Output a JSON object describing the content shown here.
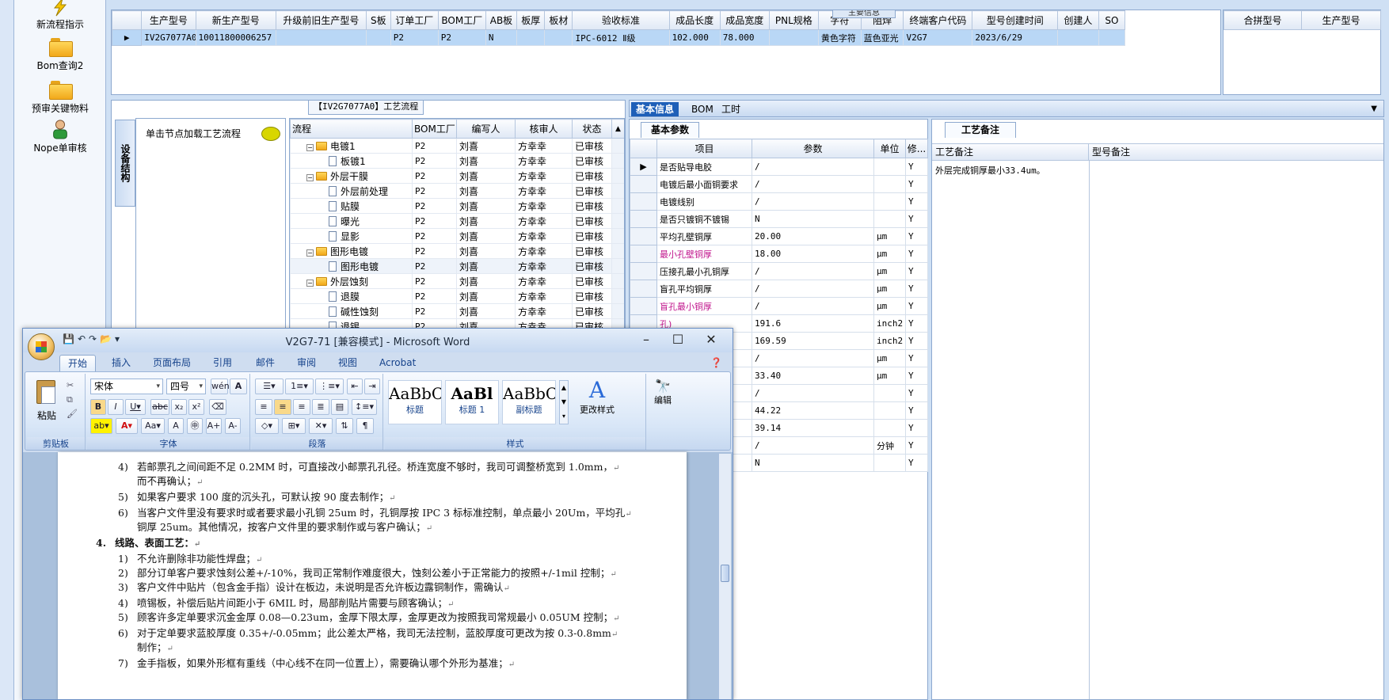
{
  "launcher": {
    "items": [
      {
        "label": "新流程指示"
      },
      {
        "label": "Bom查询2"
      },
      {
        "label": "预审关键物料"
      },
      {
        "label": "Nope单审核"
      }
    ]
  },
  "top_grid": {
    "caption": "主要信息",
    "columns": [
      "生产型号",
      "新生产型号",
      "升级前旧生产型号",
      "S板",
      "订单工厂",
      "BOM工厂",
      "AB板",
      "板厚",
      "板材",
      "验收标准",
      "成品长度",
      "成品宽度",
      "PNL规格",
      "字符",
      "阻焊",
      "终端客户代码",
      "型号创建时间",
      "创建人",
      "SO"
    ],
    "rows": [
      [
        "IV2G7077A0",
        "10011800006257",
        "",
        "",
        "P2",
        "P2",
        "N",
        "",
        "",
        "IPC-6012 Ⅱ级",
        "102.000",
        "78.000",
        "",
        "黄色字符",
        "蓝色亚光",
        "V2G7",
        "2023/6/29",
        "",
        ""
      ]
    ]
  },
  "right_grid": {
    "columns": [
      "合拼型号",
      "生产型号"
    ]
  },
  "flow_panel": {
    "title": "【IV2G7077A0】工艺流程",
    "side_tab": "设备结构",
    "node_hint": "单击节点加载工艺流程",
    "columns": [
      "流程",
      "BOM工厂",
      "编写人",
      "核审人",
      "状态"
    ],
    "rows": [
      {
        "name": "电镀1",
        "type": "folder",
        "factory": "P2",
        "writer": "刘喜",
        "reviewer": "方幸幸",
        "status": "已审核"
      },
      {
        "name": "板镀1",
        "type": "file",
        "factory": "P2",
        "writer": "刘喜",
        "reviewer": "方幸幸",
        "status": "已审核"
      },
      {
        "name": "外层干膜",
        "type": "folder",
        "factory": "P2",
        "writer": "刘喜",
        "reviewer": "方幸幸",
        "status": "已审核"
      },
      {
        "name": "外层前处理",
        "type": "file",
        "factory": "P2",
        "writer": "刘喜",
        "reviewer": "方幸幸",
        "status": "已审核"
      },
      {
        "name": "贴膜",
        "type": "file",
        "factory": "P2",
        "writer": "刘喜",
        "reviewer": "方幸幸",
        "status": "已审核"
      },
      {
        "name": "曝光",
        "type": "file",
        "factory": "P2",
        "writer": "刘喜",
        "reviewer": "方幸幸",
        "status": "已审核"
      },
      {
        "name": "显影",
        "type": "file",
        "factory": "P2",
        "writer": "刘喜",
        "reviewer": "方幸幸",
        "status": "已审核"
      },
      {
        "name": "图形电镀",
        "type": "folder",
        "factory": "P2",
        "writer": "刘喜",
        "reviewer": "方幸幸",
        "status": "已审核"
      },
      {
        "name": "图形电镀",
        "type": "file",
        "factory": "P2",
        "writer": "刘喜",
        "reviewer": "方幸幸",
        "status": "已审核"
      },
      {
        "name": "外层蚀刻",
        "type": "folder",
        "factory": "P2",
        "writer": "刘喜",
        "reviewer": "方幸幸",
        "status": "已审核"
      },
      {
        "name": "退膜",
        "type": "file",
        "factory": "P2",
        "writer": "刘喜",
        "reviewer": "方幸幸",
        "status": "已审核"
      },
      {
        "name": "碱性蚀刻",
        "type": "file",
        "factory": "P2",
        "writer": "刘喜",
        "reviewer": "方幸幸",
        "status": "已审核"
      },
      {
        "name": "退锡",
        "type": "file",
        "factory": "P2",
        "writer": "刘喜",
        "reviewer": "方幸幸",
        "status": "已审核"
      }
    ]
  },
  "info_tabs": [
    "基本信息",
    "BOM",
    "工时"
  ],
  "basic_params": {
    "tab": "基本参数",
    "columns": [
      "项目",
      "参数",
      "单位",
      "修..."
    ],
    "rows": [
      {
        "item": "是否贴导电胶",
        "param": "/",
        "unit": "",
        "flag": "Y",
        "pink": false
      },
      {
        "item": "电镀后最小面铜要求",
        "param": "/",
        "unit": "",
        "flag": "Y",
        "pink": false
      },
      {
        "item": "电镀线别",
        "param": "/",
        "unit": "",
        "flag": "Y",
        "pink": false
      },
      {
        "item": "是否只镀铜不镀锡",
        "param": "N",
        "unit": "",
        "flag": "Y",
        "pink": false
      },
      {
        "item": "平均孔壁铜厚",
        "param": "20.00",
        "unit": "μm",
        "flag": "Y",
        "pink": false
      },
      {
        "item": "最小孔壁铜厚",
        "param": "18.00",
        "unit": "μm",
        "flag": "Y",
        "pink": true
      },
      {
        "item": "压接孔最小孔铜厚",
        "param": "/",
        "unit": "μm",
        "flag": "Y",
        "pink": false
      },
      {
        "item": "盲孔平均铜厚",
        "param": "/",
        "unit": "μm",
        "flag": "Y",
        "pink": false
      },
      {
        "item": "盲孔最小铜厚",
        "param": "/",
        "unit": "μm",
        "flag": "Y",
        "pink": true
      },
      {
        "item": "孔)",
        "param": "191.6",
        "unit": "inch2",
        "flag": "Y",
        "pink": true
      },
      {
        "item": "孔)",
        "param": "169.59",
        "unit": "inch2",
        "flag": "Y",
        "pink": true
      },
      {
        "item": "",
        "param": "/",
        "unit": "μm",
        "flag": "Y",
        "pink": false
      },
      {
        "item": "",
        "param": "33.40",
        "unit": "μm",
        "flag": "Y",
        "pink": false
      },
      {
        "item": "小)",
        "param": "/",
        "unit": "",
        "flag": "Y",
        "pink": false
      },
      {
        "item": "",
        "param": "44.22",
        "unit": "",
        "flag": "Y",
        "pink": false
      },
      {
        "item": "",
        "param": "39.14",
        "unit": "",
        "flag": "Y",
        "pink": false
      },
      {
        "item": "",
        "param": "/",
        "unit": "分钟",
        "flag": "Y",
        "pink": false
      },
      {
        "item": "",
        "param": "N",
        "unit": "",
        "flag": "Y",
        "pink": false
      }
    ]
  },
  "notes": {
    "tab": "工艺备注",
    "col1": "工艺备注",
    "col2": "型号备注",
    "text": "外层完成铜厚最小33.4um。"
  },
  "word": {
    "title": "V2G7-71 [兼容模式] - Microsoft Word",
    "tabs": [
      "开始",
      "插入",
      "页面布局",
      "引用",
      "邮件",
      "审阅",
      "视图",
      "Acrobat"
    ],
    "font_name": "宋体",
    "font_size": "四号",
    "groups": {
      "clipboard": "剪贴板",
      "font": "字体",
      "paragraph": "段落",
      "styles": "样式"
    },
    "paste": "粘贴",
    "styles": [
      {
        "sample": "AaBbC",
        "name": "标题"
      },
      {
        "sample": "AaBl",
        "name": "标题 1"
      },
      {
        "sample": "AaBbC",
        "name": "副标题"
      }
    ],
    "change_styles": "更改样式",
    "edit": "编辑",
    "lines": [
      {
        "num": "4)",
        "text": "若邮票孔之间间距不足 0.2MM 时，可直接改小邮票孔孔径。桥连宽度不够时，我司可调整桥宽到 1.0mm，",
        "indent": 1
      },
      {
        "num": "",
        "text": "而不再确认；",
        "indent": 2
      },
      {
        "num": "5)",
        "text": "如果客户要求 100 度的沉头孔，可默认按 90 度去制作；",
        "indent": 1
      },
      {
        "num": "6)",
        "text": "当客户文件里没有要求时或者要求最小孔铜 25um 时，孔铜厚按 IPC 3 标标准控制，单点最小 20Um，平均孔",
        "indent": 1
      },
      {
        "num": "",
        "text": "铜厚 25um。其他情况，按客户文件里的要求制作或与客户确认；",
        "indent": 2
      },
      {
        "num": "4.",
        "text": "线路、表面工艺：",
        "indent": 0
      },
      {
        "num": "1)",
        "text": "不允许删除非功能性焊盘；",
        "indent": 1
      },
      {
        "num": "2)",
        "text": "部分订单客户要求蚀刻公差+/-10%，我司正常制作难度很大，蚀刻公差小于正常能力的按照+/-1mil 控制；",
        "indent": 1
      },
      {
        "num": "3)",
        "text": "客户文件中贴片（包含金手指）设计在板边，未说明是否允许板边露铜制作，需确认",
        "indent": 1
      },
      {
        "num": "4)",
        "text": "喷锡板，补偿后贴片间距小于 6MIL 时，局部削贴片需要与顾客确认；",
        "indent": 1
      },
      {
        "num": "5)",
        "text": "顾客许多定单要求沉金金厚 0.08—0.23um，金厚下限太厚，金厚更改为按照我司常规最小 0.05UM 控制；",
        "indent": 1
      },
      {
        "num": "6)",
        "text": "对于定单要求蓝胶厚度 0.35+/-0.05mm；此公差太严格，我司无法控制，蓝胶厚度可更改为按 0.3-0.8mm",
        "indent": 1
      },
      {
        "num": "",
        "text": "制作；",
        "indent": 2
      },
      {
        "num": "7)",
        "text": "金手指板，如果外形框有重线（中心线不在同一位置上），需要确认哪个外形为基准；",
        "indent": 1
      }
    ]
  }
}
